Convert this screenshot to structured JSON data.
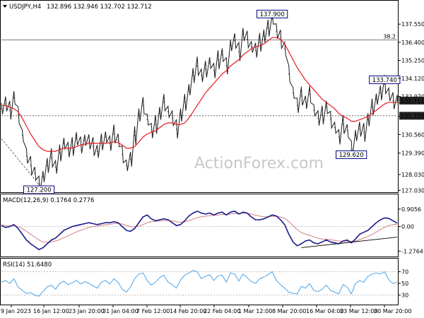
{
  "header": {
    "symbol": "USDJPY,H4",
    "ohlc": "132.896 132.946 132.702 132.712"
  },
  "watermark": "ActionForex.com",
  "colors": {
    "price": "#1a1a1a",
    "ma": "#e8191e",
    "macd": "#1a1a8a",
    "signal": "#d08080",
    "rsi": "#4aa3e8",
    "label_border": "#000080",
    "label_text": "#000080",
    "level_line": "#555555"
  },
  "chart_data": [
    {
      "type": "line",
      "panel": "price",
      "ylim": [
        127.0,
        138.9
      ],
      "y_ticks": [
        "137.550",
        "136.400",
        "135.250",
        "134.120",
        "132.970",
        "131.720",
        "130.560",
        "129.390",
        "128.030",
        "127.030"
      ],
      "y_tick_values": [
        137.55,
        136.4,
        135.25,
        134.12,
        132.97,
        131.72,
        130.56,
        129.39,
        128.03,
        127.03
      ],
      "x_tick_labels": [
        "9 Jan 2023",
        "16 Jan 12:00",
        "23 Jan 20:00",
        "31 Jan 04:00",
        "7 Feb 12:00",
        "14 Feb 20:00",
        "22 Feb 04:00",
        "1 Mar 12:00",
        "8 Mar 20:00",
        "16 Mar 04:00",
        "23 Mar 12:00",
        "30 Mar 20:00"
      ],
      "series": [
        {
          "role": "price",
          "values": [
            132.2,
            132.5,
            132.1,
            132.9,
            131.8,
            130.5,
            129.2,
            128.6,
            128.1,
            127.4,
            127.9,
            128.6,
            129.1,
            128.5,
            129.4,
            130.0,
            129.6,
            129.8,
            130.3,
            129.9,
            130.2,
            130.1,
            129.8,
            129.5,
            130.1,
            130.4,
            130.0,
            130.6,
            130.2,
            129.3,
            128.6,
            129.0,
            130.5,
            131.8,
            132.4,
            131.5,
            130.8,
            131.2,
            131.9,
            132.6,
            132.0,
            131.6,
            130.9,
            131.8,
            132.6,
            133.4,
            134.3,
            134.9,
            134.3,
            134.7,
            135.1,
            134.6,
            135.3,
            135.6,
            134.9,
            136.2,
            136.5,
            135.8,
            136.9,
            136.6,
            136.1,
            135.9,
            136.4,
            136.8,
            137.3,
            137.9,
            137.1,
            136.6,
            136.0,
            134.4,
            133.2,
            132.4,
            133.0,
            132.6,
            133.1,
            132.1,
            131.6,
            131.8,
            132.3,
            131.5,
            131.0,
            130.4,
            131.2,
            130.8,
            129.62,
            130.5,
            130.9,
            130.7,
            131.5,
            132.3,
            132.8,
            133.2,
            133.74,
            133.1,
            132.7,
            132.712
          ],
          "marker": "bars"
        },
        {
          "role": "moving-average",
          "values": [
            132.4,
            132.4,
            132.3,
            132.2,
            132.0,
            131.6,
            131.1,
            130.6,
            130.2,
            129.8,
            129.6,
            129.5,
            129.5,
            129.5,
            129.6,
            129.7,
            129.7,
            129.7,
            129.8,
            129.9,
            129.95,
            130.0,
            130.0,
            130.0,
            130.0,
            130.0,
            130.05,
            130.1,
            130.05,
            129.9,
            129.7,
            129.7,
            129.8,
            130.1,
            130.4,
            130.6,
            130.7,
            130.8,
            131.0,
            131.2,
            131.3,
            131.3,
            131.2,
            131.2,
            131.3,
            131.6,
            132.0,
            132.4,
            132.8,
            133.2,
            133.5,
            133.8,
            134.1,
            134.4,
            134.6,
            134.9,
            135.1,
            135.3,
            135.6,
            135.8,
            136.0,
            136.1,
            136.2,
            136.3,
            136.5,
            136.7,
            136.7,
            136.6,
            136.3,
            135.8,
            135.3,
            134.8,
            134.4,
            134.0,
            133.7,
            133.4,
            133.1,
            132.8,
            132.6,
            132.4,
            132.2,
            131.9,
            131.7,
            131.6,
            131.4,
            131.4,
            131.5,
            131.6,
            131.7,
            131.9,
            132.1,
            132.3,
            132.5,
            132.6,
            132.6,
            132.6
          ]
        }
      ],
      "levels": [
        {
          "label": "38.2",
          "value": 136.55
        },
        {
          "label": "131.750",
          "value": 131.75
        }
      ],
      "annotations": [
        {
          "text": "137.900",
          "x_index": 65,
          "value": 137.9
        },
        {
          "text": "133.740",
          "x_index": 92,
          "value": 133.74
        },
        {
          "text": "129.620",
          "x_index": 84,
          "value": 129.62
        },
        {
          "text": "127.200",
          "x_index": 9,
          "value": 127.4
        }
      ],
      "last_price_label": "132.712",
      "level_label": "131.750"
    },
    {
      "type": "line",
      "panel": "macd",
      "title": "MACD(12,26,9) 0.1764 0.2776",
      "ylim": [
        -1.45,
        1.05
      ],
      "y_ticks": [
        "0.9056",
        "0.00",
        "-1.2764"
      ],
      "y_tick_values": [
        0.9056,
        0.0,
        -1.2764
      ],
      "series": [
        {
          "role": "macd",
          "values": [
            0.05,
            -0.05,
            0.0,
            0.1,
            -0.1,
            -0.4,
            -0.7,
            -0.9,
            -1.05,
            -1.2,
            -1.1,
            -0.9,
            -0.7,
            -0.6,
            -0.4,
            -0.2,
            -0.1,
            0.0,
            0.05,
            0.1,
            0.15,
            0.2,
            0.15,
            0.1,
            0.15,
            0.2,
            0.2,
            0.25,
            0.2,
            0.0,
            -0.2,
            -0.25,
            -0.1,
            0.2,
            0.5,
            0.6,
            0.4,
            0.3,
            0.35,
            0.4,
            0.35,
            0.2,
            0.05,
            0.1,
            0.3,
            0.55,
            0.7,
            0.8,
            0.7,
            0.65,
            0.7,
            0.6,
            0.7,
            0.75,
            0.6,
            0.75,
            0.8,
            0.65,
            0.75,
            0.7,
            0.5,
            0.35,
            0.35,
            0.4,
            0.5,
            0.6,
            0.55,
            0.35,
            0.1,
            -0.4,
            -0.8,
            -1.0,
            -0.9,
            -0.75,
            -0.7,
            -0.85,
            -0.9,
            -0.8,
            -0.7,
            -0.8,
            -0.85,
            -0.9,
            -0.75,
            -0.7,
            -0.85,
            -0.65,
            -0.4,
            -0.3,
            -0.2,
            0.0,
            0.2,
            0.35,
            0.45,
            0.42,
            0.3,
            0.18
          ]
        },
        {
          "role": "signal",
          "values": [
            0.1,
            0.05,
            0.03,
            0.05,
            0.0,
            -0.1,
            -0.25,
            -0.4,
            -0.55,
            -0.7,
            -0.8,
            -0.82,
            -0.8,
            -0.75,
            -0.68,
            -0.58,
            -0.48,
            -0.38,
            -0.28,
            -0.2,
            -0.12,
            -0.05,
            0.0,
            0.03,
            0.06,
            0.09,
            0.12,
            0.15,
            0.16,
            0.13,
            0.06,
            0.0,
            -0.02,
            0.02,
            0.1,
            0.2,
            0.25,
            0.27,
            0.29,
            0.31,
            0.32,
            0.3,
            0.25,
            0.22,
            0.24,
            0.3,
            0.38,
            0.46,
            0.51,
            0.54,
            0.57,
            0.58,
            0.6,
            0.63,
            0.62,
            0.65,
            0.68,
            0.67,
            0.69,
            0.69,
            0.65,
            0.59,
            0.54,
            0.51,
            0.51,
            0.53,
            0.53,
            0.5,
            0.42,
            0.26,
            0.05,
            -0.16,
            -0.31,
            -0.4,
            -0.46,
            -0.54,
            -0.61,
            -0.65,
            -0.66,
            -0.69,
            -0.72,
            -0.76,
            -0.76,
            -0.75,
            -0.77,
            -0.75,
            -0.68,
            -0.6,
            -0.52,
            -0.41,
            -0.29,
            -0.16,
            -0.04,
            0.05,
            0.1,
            0.12
          ]
        }
      ],
      "trendline": {
        "from": {
          "x_index": 72,
          "value": -1.1
        },
        "to": {
          "x_index": 96,
          "value": -0.55
        }
      }
    },
    {
      "type": "line",
      "panel": "rsi",
      "title": "RSI(14) 51.6480",
      "ylim": [
        15,
        90
      ],
      "y_ticks": [
        "70",
        "50",
        "30"
      ],
      "y_tick_values": [
        70,
        50,
        30
      ],
      "series": [
        {
          "role": "rsi",
          "values": [
            52,
            55,
            50,
            58,
            44,
            38,
            33,
            34,
            30,
            28,
            36,
            44,
            47,
            40,
            50,
            54,
            48,
            51,
            55,
            49,
            53,
            50,
            46,
            42,
            52,
            55,
            49,
            58,
            52,
            40,
            35,
            44,
            58,
            66,
            68,
            55,
            47,
            52,
            60,
            64,
            52,
            48,
            42,
            56,
            64,
            68,
            72,
            70,
            58,
            62,
            65,
            55,
            63,
            64,
            52,
            68,
            66,
            54,
            66,
            60,
            53,
            50,
            58,
            61,
            65,
            70,
            55,
            48,
            42,
            35,
            33,
            32,
            45,
            42,
            50,
            38,
            36,
            40,
            47,
            38,
            35,
            32,
            48,
            44,
            32,
            50,
            55,
            52,
            62,
            66,
            68,
            66,
            70,
            56,
            50,
            51.6
          ]
        }
      ]
    }
  ]
}
